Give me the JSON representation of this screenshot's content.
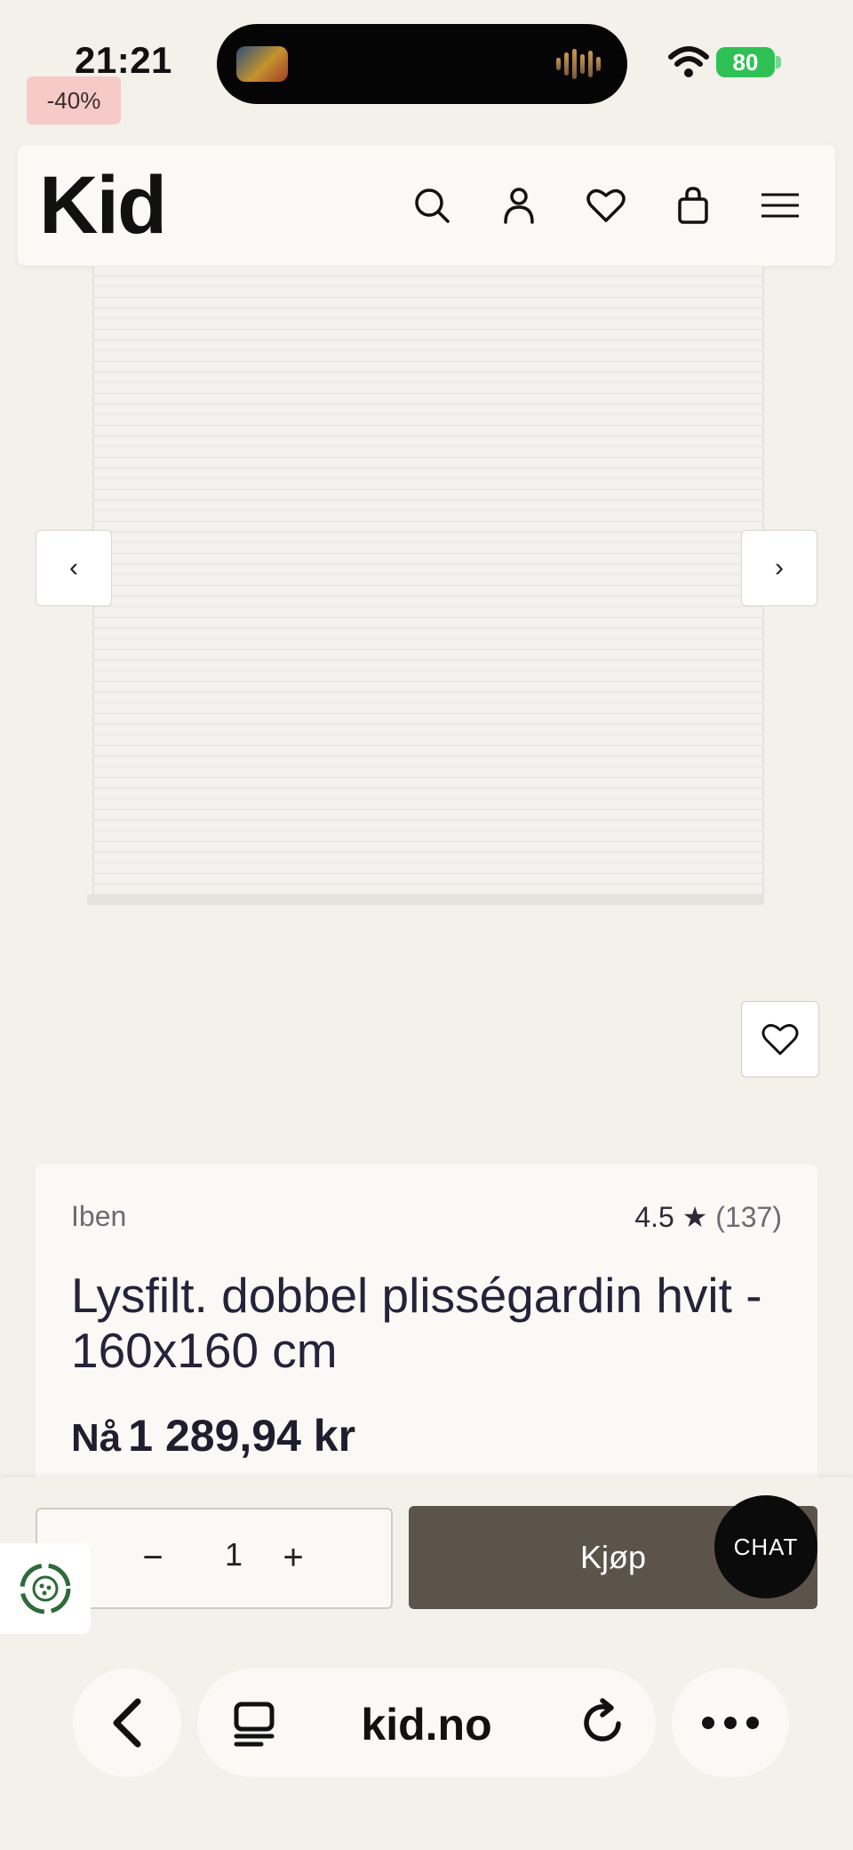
{
  "status": {
    "time": "21:21",
    "battery": "80"
  },
  "badge": {
    "discount": "-40%"
  },
  "header": {
    "logo": "Kid",
    "icons": [
      "search-icon",
      "account-icon",
      "wishlist-icon",
      "cart-icon",
      "menu-icon"
    ]
  },
  "carousel": {
    "prev": "‹",
    "next": "›"
  },
  "product": {
    "brand": "Iben",
    "rating": "4.5",
    "rating_star": "★",
    "review_count": "(137)",
    "title": "Lysfilt. dobbel plisségardin hvit - 160x160 cm",
    "price_prefix": "Nå",
    "price": "1 289,94 kr"
  },
  "actions": {
    "quantity": "1",
    "minus": "−",
    "plus": "+",
    "buy_label": "Kjøp",
    "chat_label": "CHAT"
  },
  "browser": {
    "url": "kid.no"
  },
  "colors": {
    "background": "#f4f0ea",
    "buy_button": "#5c534b",
    "badge": "#f6cac6",
    "battery": "#2fc155"
  }
}
